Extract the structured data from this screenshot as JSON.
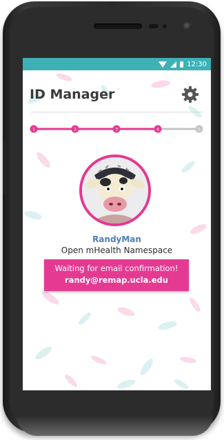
{
  "status_bar": {
    "time": "12:30"
  },
  "header": {
    "title": "ID Manager",
    "settings_icon": "gear-icon"
  },
  "stepper": {
    "steps": [
      "1",
      "2",
      "3",
      "4",
      "5"
    ],
    "current_step": 4,
    "active_color": "#e5388f",
    "inactive_color": "#c4c4c4"
  },
  "profile": {
    "avatar_icon": "cow-mask-avatar",
    "username": "RandyMan",
    "namespace": "Open mHealth Namespace"
  },
  "status_message": {
    "line1": "Waiting for email confirmation!",
    "line2": "randy@remap.ucla.edu"
  },
  "colors": {
    "accent": "#e5388f",
    "status_bar": "#3fb1b6",
    "name_blue": "#4c7fb6"
  }
}
